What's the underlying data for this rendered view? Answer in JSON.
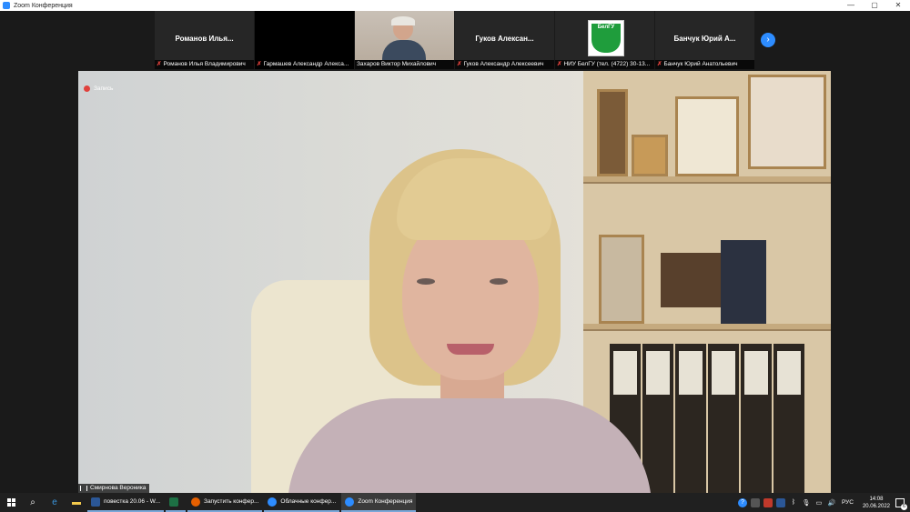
{
  "window": {
    "title": "Zoom Конференция",
    "controls": {
      "minimize": "—",
      "maximize": "▢",
      "close": "✕"
    }
  },
  "gallery": {
    "tiles": [
      {
        "name": "Романов Илья...",
        "caption": "Романов Илья Владимирович",
        "muted": true,
        "video": false
      },
      {
        "name": "",
        "caption": "Гармашев Александр Алекса...",
        "muted": true,
        "video": false
      },
      {
        "name": "",
        "caption": "Захаров Виктор Михайлович",
        "muted": false,
        "video": true
      },
      {
        "name": "Гуков Алексан...",
        "caption": "Гуков Александр Алексеевич",
        "muted": true,
        "video": false
      },
      {
        "name": "",
        "caption": "НИУ БелГУ (тел. (4722) 30-13...",
        "muted": true,
        "video": false,
        "logo_text": "БелГУ"
      },
      {
        "name": "Банчук Юрий А...",
        "caption": "Банчук Юрий Анатольевич",
        "muted": true,
        "video": false
      }
    ],
    "next_icon": "chevron-right-icon"
  },
  "main": {
    "recording_label": "Запись",
    "speaker_name": "Смирнова Вероника"
  },
  "taskbar": {
    "apps": [
      {
        "label": "повестка 20.06 - W...",
        "icon_color": "#2b5797"
      },
      {
        "label": "",
        "icon_color": "#1d7044"
      },
      {
        "label": "Запустить конфер...",
        "icon_color": "#e66000"
      },
      {
        "label": "Облачные конфер...",
        "icon_color": "#2d8cff"
      },
      {
        "label": "Zoom Конференция",
        "icon_color": "#2d8cff"
      }
    ],
    "lang": "РУС",
    "time": "14:08",
    "date": "20.06.2022",
    "notifications": "6"
  },
  "colors": {
    "accent": "#2d8cff",
    "mute": "#e0413c",
    "taskbar": "#202020"
  }
}
